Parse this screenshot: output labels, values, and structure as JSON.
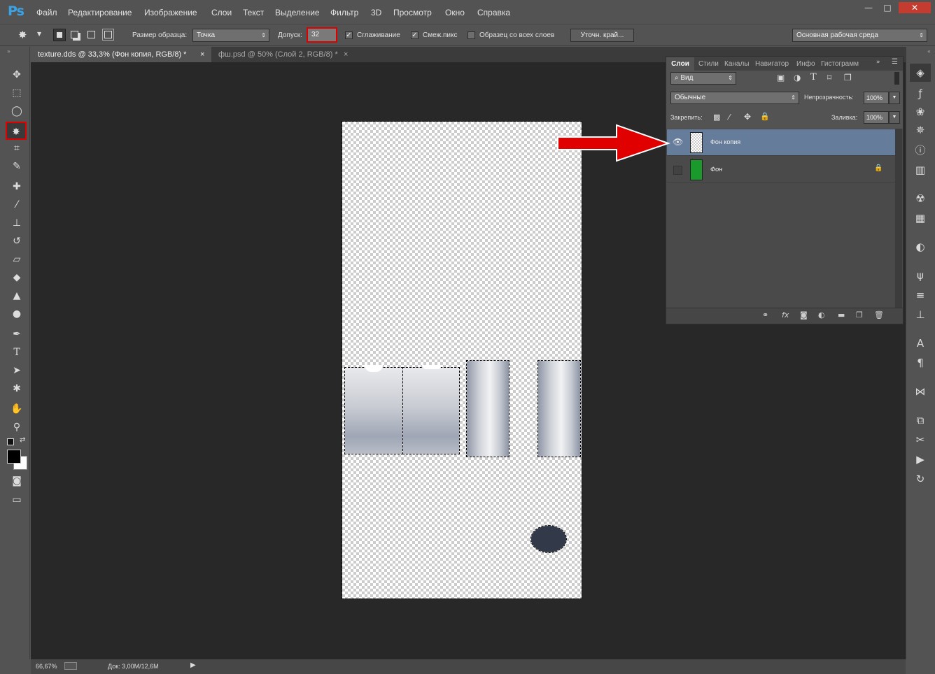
{
  "app": {
    "logo": "Ps"
  },
  "menu": [
    "Файл",
    "Редактирование",
    "Изображение",
    "Слои",
    "Текст",
    "Выделение",
    "Фильтр",
    "3D",
    "Просмотр",
    "Окно",
    "Справка"
  ],
  "window_controls": {
    "minimize": "—",
    "restore": "□",
    "close": "✕"
  },
  "options": {
    "sample_size_label": "Размер образца:",
    "sample_size_value": "Точка",
    "tolerance_label": "Допуск:",
    "tolerance_value": "32",
    "antialias_label": "Сглаживание",
    "contiguous_label": "Смеж.пикс",
    "all_layers_label": "Образец со всех слоев",
    "refine_edge_button": "Уточн. край...",
    "workspace": "Основная рабочая среда",
    "antialias_checked": true,
    "contiguous_checked": true,
    "all_layers_checked": false
  },
  "tabs": [
    {
      "label": "texture.dds @ 33,3% (Фон копия, RGB/8) *",
      "close": "×",
      "active": true
    },
    {
      "label": "фш.psd @ 50% (Слой 2, RGB/8) *",
      "close": "×",
      "active": false
    }
  ],
  "layers_panel": {
    "tabs": [
      "Слои",
      "Стили",
      "Каналы",
      "Навигатор",
      "Инфо",
      "Гистограмм"
    ],
    "filter_kind": "Вид",
    "blend_mode": "Обычные",
    "opacity_label": "Непрозрачность:",
    "opacity_value": "100%",
    "lock_label": "Закрепить:",
    "fill_label": "Заливка:",
    "fill_value": "100%",
    "layers": [
      {
        "name": "Фон копия",
        "visible": true,
        "selected": true,
        "locked": false
      },
      {
        "name": "Фон",
        "visible": false,
        "selected": false,
        "locked": true
      }
    ]
  },
  "status": {
    "zoom": "66,67%",
    "doc_info": "Док: 3,00M/12,6M"
  },
  "colors": {
    "accent_red": "#e00000",
    "selected_layer": "#667c9b",
    "green_thumb": "#1a9a2b",
    "ps_blue": "#3aa3e8"
  }
}
